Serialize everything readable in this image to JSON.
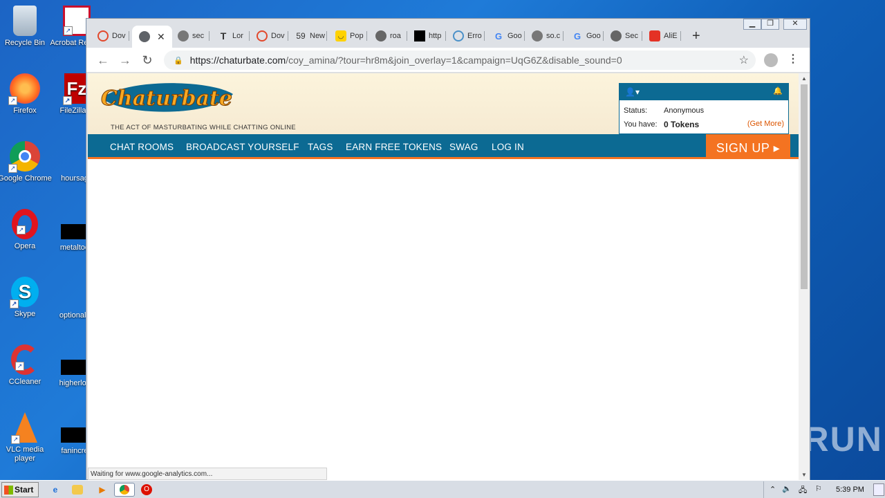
{
  "desktop": {
    "icons": [
      {
        "label": "Recycle Bin",
        "icon": "recycle-bin-icon"
      },
      {
        "label": "Acrobat Reader",
        "icon": "acrobat-icon"
      },
      {
        "label": "Firefox",
        "icon": "firefox-icon"
      },
      {
        "label": "FileZilla C",
        "icon": "filezilla-icon"
      },
      {
        "label": "Google Chrome",
        "icon": "chrome-icon"
      },
      {
        "label": "hoursage",
        "icon": "file-icon"
      },
      {
        "label": "Opera",
        "icon": "opera-icon"
      },
      {
        "label": "metaltoda",
        "icon": "file-icon"
      },
      {
        "label": "Skype",
        "icon": "skype-icon"
      },
      {
        "label": "optionalch",
        "icon": "file-icon"
      },
      {
        "label": "CCleaner",
        "icon": "ccleaner-icon"
      },
      {
        "label": "higherlove",
        "icon": "file-icon"
      },
      {
        "label": "VLC media player",
        "icon": "vlc-icon"
      },
      {
        "label": "fanincrea",
        "icon": "file-icon"
      }
    ],
    "watermark": "ANY RUN"
  },
  "browser": {
    "tabs": [
      {
        "title": "Dov",
        "favicon": "flash-icon"
      },
      {
        "title": "",
        "favicon": "globe-icon",
        "active": true
      },
      {
        "title": "sec",
        "favicon": "globe-icon"
      },
      {
        "title": "Lor",
        "favicon": "t-icon"
      },
      {
        "title": "Dov",
        "favicon": "flash-icon"
      },
      {
        "title": "New",
        "favicon": "59-icon"
      },
      {
        "title": "Pop",
        "favicon": "smiley-icon"
      },
      {
        "title": "roa",
        "favicon": "globe-icon"
      },
      {
        "title": "http",
        "favicon": "black-square-icon"
      },
      {
        "title": "Erro",
        "favicon": "stripes-icon"
      },
      {
        "title": "Goo",
        "favicon": "google-icon"
      },
      {
        "title": "so.c",
        "favicon": "globe-icon"
      },
      {
        "title": "Goo",
        "favicon": "google-icon"
      },
      {
        "title": "Sec",
        "favicon": "globe-icon"
      },
      {
        "title": "AliE",
        "favicon": "aliexpress-icon"
      }
    ],
    "url_host": "https://chaturbate.com",
    "url_path": "/coy_amina/?tour=hr8m&join_overlay=1&campaign=UqG6Z&disable_sound=0",
    "status_text": "Waiting for www.google-analytics.com..."
  },
  "page": {
    "logo_text": "Chaturbate",
    "tagline": "THE ACT OF MASTURBATING WHILE CHATTING ONLINE",
    "user": {
      "status_label": "Status:",
      "status_value": "Anonymous",
      "tokens_label": "You have:",
      "tokens_value": "0 Tokens",
      "get_more": "(Get More)"
    },
    "nav": [
      "CHAT ROOMS",
      "BROADCAST YOURSELF",
      "TAGS",
      "EARN FREE TOKENS",
      "SWAG",
      "LOG IN"
    ],
    "signup": "SIGN UP ▸"
  },
  "taskbar": {
    "start": "Start",
    "clock": "5:39 PM"
  },
  "colors": {
    "accent_blue": "#0c6a93",
    "accent_orange": "#f47321"
  }
}
